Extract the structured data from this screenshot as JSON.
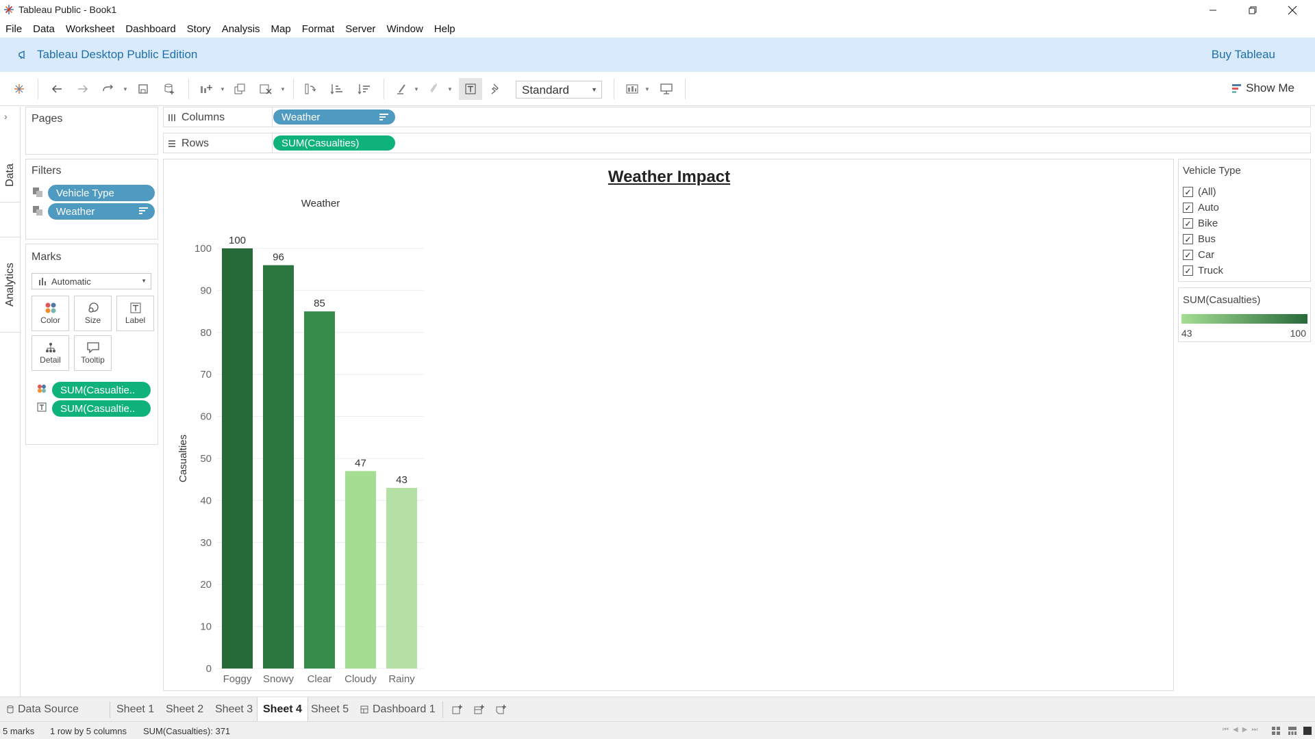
{
  "window": {
    "title": "Tableau Public - Book1"
  },
  "menu": [
    "File",
    "Data",
    "Worksheet",
    "Dashboard",
    "Story",
    "Analysis",
    "Map",
    "Format",
    "Server",
    "Window",
    "Help"
  ],
  "banner": {
    "edition": "Tableau Desktop Public Edition",
    "buy": "Buy Tableau"
  },
  "toolbar": {
    "fit": "Standard",
    "show_me": "Show Me"
  },
  "side_tabs": {
    "data": "Data",
    "analytics": "Analytics"
  },
  "pages": {
    "title": "Pages"
  },
  "filters": {
    "title": "Filters",
    "items": [
      "Vehicle Type",
      "Weather"
    ]
  },
  "marks": {
    "title": "Marks",
    "type": "Automatic",
    "buttons": [
      "Color",
      "Size",
      "Label",
      "Detail",
      "Tooltip"
    ],
    "pills": [
      "SUM(Casualtie..",
      "SUM(Casualtie.."
    ]
  },
  "shelves": {
    "columns_label": "Columns",
    "columns_pill": "Weather",
    "rows_label": "Rows",
    "rows_pill": "SUM(Casualties)"
  },
  "legend": {
    "filter_title": "Vehicle Type",
    "filter_options": [
      "(All)",
      "Auto",
      "Bike",
      "Bus",
      "Car",
      "Truck"
    ],
    "color_title": "SUM(Casualties)",
    "color_min": "43",
    "color_max": "100",
    "color_low": "#a4de92",
    "color_high": "#276a3a"
  },
  "chart_data": {
    "type": "bar",
    "title": "Weather Impact",
    "header": "Weather",
    "ylabel": "Casualties",
    "categories": [
      "Foggy",
      "Snowy",
      "Clear",
      "Cloudy",
      "Rainy"
    ],
    "values": [
      100,
      96,
      85,
      47,
      43
    ],
    "bar_colors": [
      "#276a3a",
      "#2b763f",
      "#388c4b",
      "#a4de92",
      "#b4e0a6"
    ],
    "yticks": [
      0,
      10,
      20,
      30,
      40,
      50,
      60,
      70,
      80,
      90,
      100
    ],
    "ylim": [
      0,
      100
    ],
    "grid": true
  },
  "sheet_tabs": {
    "data_source": "Data Source",
    "sheets": [
      "Sheet 1",
      "Sheet 2",
      "Sheet 3",
      "Sheet 4",
      "Sheet 5"
    ],
    "active": "Sheet 4",
    "dashboard": "Dashboard 1"
  },
  "status": {
    "marks": "5 marks",
    "dims": "1 row by 5 columns",
    "sum": "SUM(Casualties): 371"
  }
}
